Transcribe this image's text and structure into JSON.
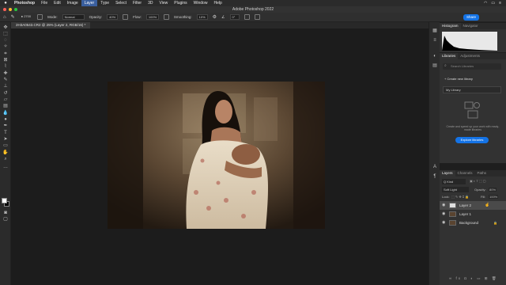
{
  "menubar": {
    "apple": "",
    "items": [
      "Photoshop",
      "File",
      "Edit",
      "Image",
      "Layer",
      "Type",
      "Select",
      "Filter",
      "3D",
      "View",
      "Plugins",
      "Window",
      "Help"
    ],
    "active_index": 4,
    "right": [
      "",
      "",
      ""
    ]
  },
  "window": {
    "title": "Adobe Photoshop 2022"
  },
  "options": {
    "brush_size": "2700",
    "mode_label": "Mode:",
    "mode_value": "Normal",
    "opacity_label": "Opacity:",
    "opacity_value": "40%",
    "flow_label": "Flow:",
    "flow_value": "100%",
    "smoothing_label": "Smoothing:",
    "smoothing_value": "10%",
    "angle_value": "0°",
    "share_label": "Share"
  },
  "document": {
    "tab_label": "2H3A0543.CR2 @ 25% (Layer 2, RGB/16) *"
  },
  "panels": {
    "histogram_tabs": [
      "Histogram",
      "Navigator"
    ],
    "libraries_tabs": [
      "Libraries",
      "Adjustments"
    ],
    "search_placeholder": "Search Libraries",
    "create_library": "+ Create new library",
    "my_library": "My Library",
    "lib_desc": "Create and speed up your work with ready-made libraries",
    "explore_button": "Explore libraries",
    "layers_tabs": [
      "Layers",
      "Channels",
      "Paths"
    ],
    "kind_label": "Q Kind",
    "blend_mode": "Soft Light",
    "opacity_label": "Opacity:",
    "opacity_value": "80%",
    "lock_label": "Lock:",
    "fill_label": "Fill:",
    "fill_value": "100%",
    "layers": [
      {
        "name": "Layer 2",
        "selected": true
      },
      {
        "name": "Layer 1",
        "selected": false
      },
      {
        "name": "Background",
        "selected": false
      }
    ]
  },
  "colors": {
    "accent": "#1473e6",
    "menu_active": "#3a5f9e"
  }
}
